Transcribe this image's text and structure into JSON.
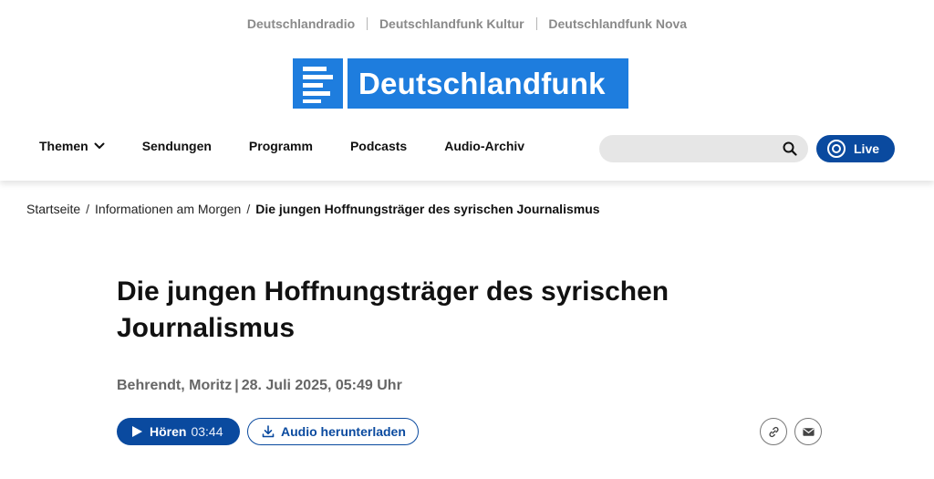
{
  "network": {
    "links": [
      "Deutschlandradio",
      "Deutschlandfunk Kultur",
      "Deutschlandfunk Nova"
    ]
  },
  "logo": {
    "text": "Deutschlandfunk",
    "color": "#1e7dde"
  },
  "menu": {
    "themen": "Themen",
    "sendungen": "Sendungen",
    "programm": "Programm",
    "podcasts": "Podcasts",
    "audio_archiv": "Audio-Archiv"
  },
  "search": {
    "placeholder": "",
    "icon": "search-icon"
  },
  "live": {
    "label": "Live",
    "color": "#0a4a9f"
  },
  "breadcrumb": {
    "home": "Startseite",
    "section": "Informationen am Morgen",
    "current": "Die jungen Hoffnungsträger des syrischen Journalismus"
  },
  "article": {
    "title": "Die jungen Hoffnungsträger des syrischen Journalismus",
    "author": "Behrendt, Moritz",
    "date": "28. Juli 2025, 05:49 Uhr"
  },
  "audio": {
    "play_label": "Hören",
    "duration": "03:44",
    "download_label": "Audio herunterladen"
  },
  "share": {
    "icons": [
      "link-icon",
      "mail-icon"
    ]
  }
}
